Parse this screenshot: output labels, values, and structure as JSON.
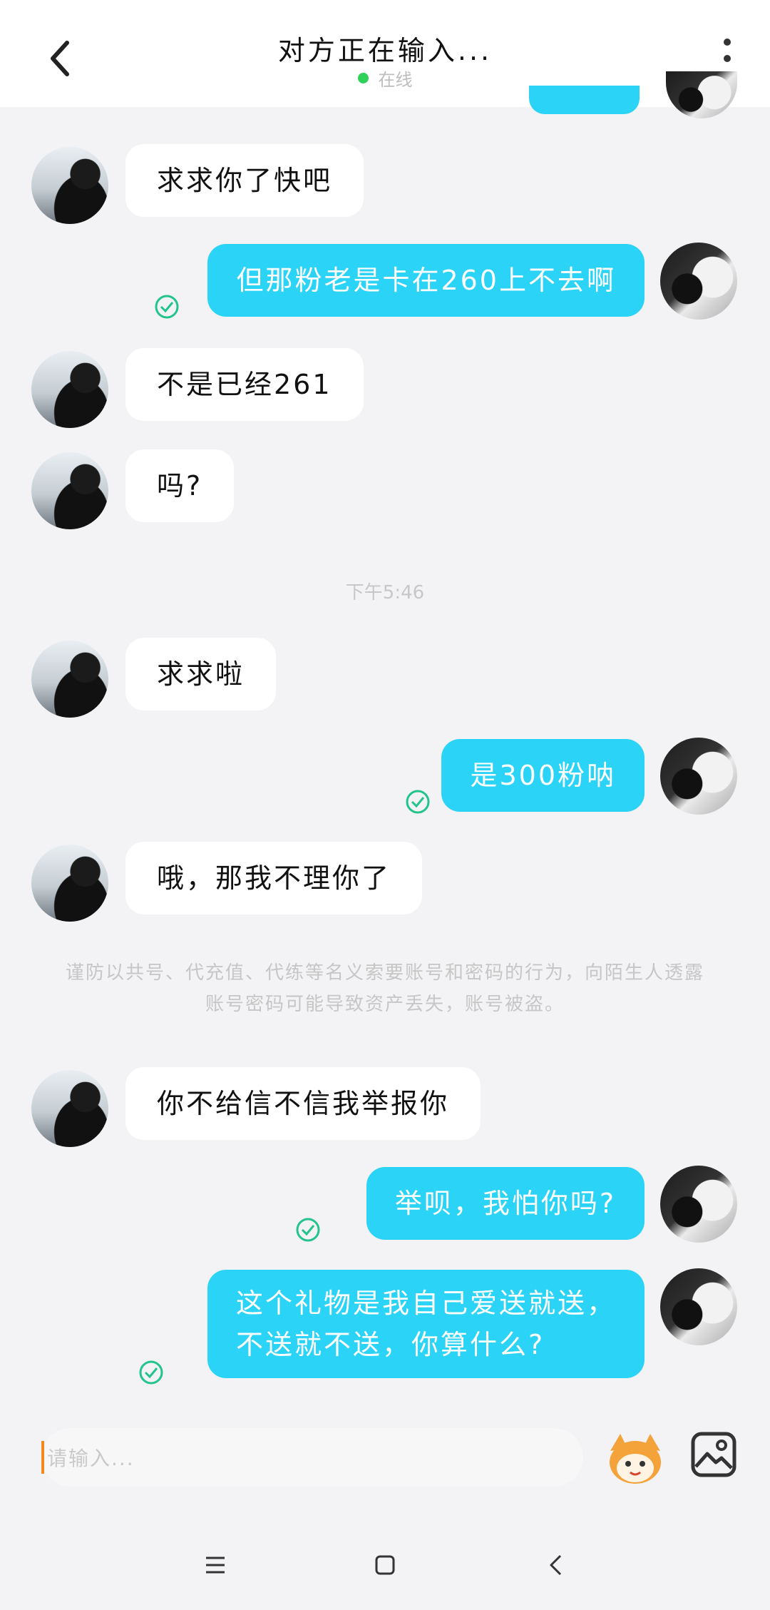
{
  "header": {
    "title": "对方正在输入...",
    "status": "在线",
    "status_color": "#2fd15a"
  },
  "messages": [
    {
      "side": "in",
      "text": "求求你了快吧"
    },
    {
      "side": "out",
      "text": "但那粉老是卡在260上不去啊"
    },
    {
      "side": "in",
      "text": "不是已经261"
    },
    {
      "side": "in",
      "text": "吗?"
    },
    {
      "side": "time",
      "text": "下午5:46"
    },
    {
      "side": "in",
      "text": "求求啦"
    },
    {
      "side": "out",
      "text": "是300粉呐"
    },
    {
      "side": "in",
      "text": "哦，那我不理你了"
    },
    {
      "side": "notice",
      "text": "谨防以共号、代充值、代练等名义索要账号和密码的行为，向陌生人透露账号密码可能导致资产丢失，账号被盗。"
    },
    {
      "side": "in",
      "text": "你不给信不信我举报你"
    },
    {
      "side": "out",
      "text": "举呗，我怕你吗?"
    },
    {
      "side": "out",
      "text_line1": "这个礼物是我自己爱送就送，",
      "text_line2": "不送就不送，你算什么?"
    }
  ],
  "input": {
    "placeholder": "请输入..."
  },
  "icons": {
    "back": "chevron-left-icon",
    "more": "more-vertical-icon",
    "read": "check-circle-icon",
    "emoji": "emoji-mascot-icon",
    "image": "image-icon",
    "nav_menu": "menu-icon",
    "nav_home": "square-icon",
    "nav_back": "triangle-back-icon"
  },
  "colors": {
    "outgoing_bubble": "#2bd3f6",
    "incoming_bubble": "#ffffff",
    "read_check": "#22c48c",
    "caret": "#f28a1c"
  }
}
